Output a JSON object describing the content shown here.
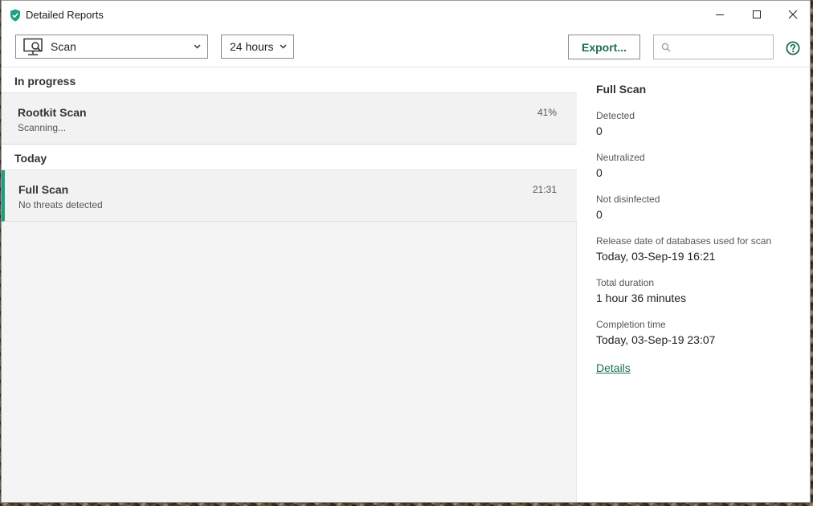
{
  "window": {
    "title": "Detailed Reports",
    "accent_color": "#1ca083",
    "link_color": "#1b6e55"
  },
  "toolbar": {
    "component_select": {
      "icon": "monitor-search-icon",
      "value": "Scan"
    },
    "period_select": {
      "value": "24 hours"
    },
    "export_label": "Export...",
    "search": {
      "value": "",
      "placeholder": ""
    },
    "help_icon": "help-icon"
  },
  "list": {
    "sections": [
      {
        "header": "In progress",
        "items": [
          {
            "title": "Rootkit Scan",
            "subtitle": "Scanning...",
            "meta": "41%",
            "selected": false
          }
        ]
      },
      {
        "header": "Today",
        "items": [
          {
            "title": "Full Scan",
            "subtitle": "No threats detected",
            "meta": "21:31",
            "selected": true
          }
        ]
      }
    ]
  },
  "details": {
    "title": "Full Scan",
    "fields": [
      {
        "label": "Detected",
        "value": "0"
      },
      {
        "label": "Neutralized",
        "value": "0"
      },
      {
        "label": "Not disinfected",
        "value": "0"
      },
      {
        "label": "Release date of databases used for scan",
        "value": "Today, 03-Sep-19 16:21"
      },
      {
        "label": "Total duration",
        "value": "1 hour 36 minutes"
      },
      {
        "label": "Completion time",
        "value": "Today, 03-Sep-19 23:07"
      }
    ],
    "link_label": "Details"
  }
}
